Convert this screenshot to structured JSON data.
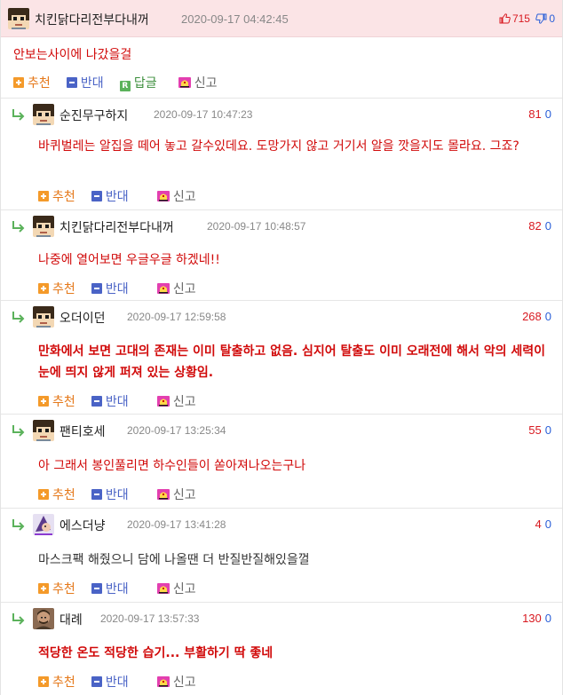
{
  "post": {
    "author": "치킨닭다리전부다내꺼",
    "date": "2020-09-17 04:42:45",
    "upvotes": "715",
    "downvotes": "0",
    "title": "안보는사이에 나갔을걸",
    "actions": {
      "recommend": "추천",
      "oppose": "반대",
      "reply_icon": "R",
      "reply": "답글",
      "report": "신고"
    }
  },
  "comment_actions": {
    "recommend": "추천",
    "oppose": "반대",
    "report": "신고"
  },
  "comments": [
    {
      "author": "순진무구하지",
      "date": "2020-09-17 10:47:23",
      "up": "81",
      "down": "0",
      "text": "바퀴벌레는 알집을 떼어 놓고 갈수있데요. 도망가지 않고 거기서 알을 깟을지도 몰라요. 그죠?"
    },
    {
      "author": "치킨닭다리전부다내꺼",
      "date": "2020-09-17 10:48:57",
      "up": "82",
      "down": "0",
      "text": "나중에 열어보면 우글우글 하겠네!!"
    },
    {
      "author": "오더이던",
      "date": "2020-09-17 12:59:58",
      "up": "268",
      "down": "0",
      "text": "만화에서 보면 고대의 존재는 이미 탈출하고 없음. 심지어 탈출도 이미 오래전에 해서 악의 세력이 눈에 띄지 않게 퍼져 있는 상황임."
    },
    {
      "author": "팬티호세",
      "date": "2020-09-17 13:25:34",
      "up": "55",
      "down": "0",
      "text": "아 그래서 봉인풀리면 하수인들이 쏟아져나오는구나"
    },
    {
      "author": "에스더냥",
      "date": "2020-09-17 13:41:28",
      "up": "4",
      "down": "0",
      "text": "마스크팩 해줬으니 담에 나올땐 더 반질반질해있을껄"
    },
    {
      "author": "대례",
      "date": "2020-09-17 13:57:33",
      "up": "130",
      "down": "0",
      "text": "적당한 온도 적당한 습기... 부활하기 딱 좋네"
    }
  ],
  "colors": {
    "accent_red": "#d10a0a",
    "header_bg": "#fbe4e6",
    "recommend": "#f49a2a",
    "oppose": "#4a63c6",
    "reply": "#5bb25b"
  },
  "icons": [
    "pixel-avatar-icon",
    "thumbs-up-icon",
    "thumbs-down-icon",
    "plus-icon",
    "minus-icon",
    "reply-icon",
    "report-icon",
    "reply-arrow-icon",
    "witch-avatar-icon",
    "man-avatar-icon"
  ]
}
